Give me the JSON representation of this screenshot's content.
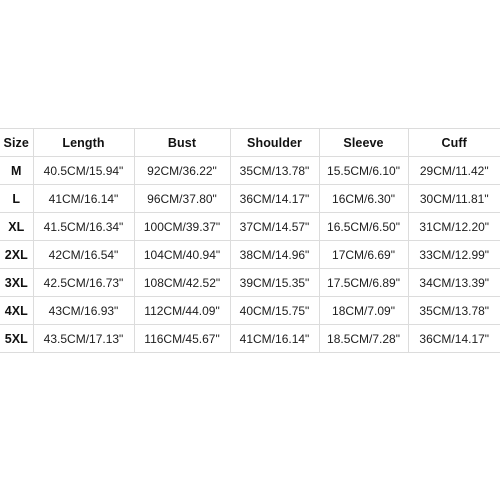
{
  "chart_data": {
    "type": "table",
    "title": "",
    "columns": [
      "Size",
      "Length",
      "Bust",
      "Shoulder",
      "Sleeve",
      "Cuff"
    ],
    "rows": [
      {
        "size": "M",
        "length": "40.5CM/15.94\"",
        "bust": "92CM/36.22\"",
        "shoulder": "35CM/13.78\"",
        "sleeve": "15.5CM/6.10\"",
        "cuff": "29CM/11.42\""
      },
      {
        "size": "L",
        "length": "41CM/16.14\"",
        "bust": "96CM/37.80\"",
        "shoulder": "36CM/14.17\"",
        "sleeve": "16CM/6.30\"",
        "cuff": "30CM/11.81\""
      },
      {
        "size": "XL",
        "length": "41.5CM/16.34\"",
        "bust": "100CM/39.37\"",
        "shoulder": "37CM/14.57\"",
        "sleeve": "16.5CM/6.50\"",
        "cuff": "31CM/12.20\""
      },
      {
        "size": "2XL",
        "length": "42CM/16.54\"",
        "bust": "104CM/40.94\"",
        "shoulder": "38CM/14.96\"",
        "sleeve": "17CM/6.69\"",
        "cuff": "33CM/12.99\""
      },
      {
        "size": "3XL",
        "length": "42.5CM/16.73\"",
        "bust": "108CM/42.52\"",
        "shoulder": "39CM/15.35\"",
        "sleeve": "17.5CM/6.89\"",
        "cuff": "34CM/13.39\""
      },
      {
        "size": "4XL",
        "length": "43CM/16.93\"",
        "bust": "112CM/44.09\"",
        "shoulder": "40CM/15.75\"",
        "sleeve": "18CM/7.09\"",
        "cuff": "35CM/13.78\""
      },
      {
        "size": "5XL",
        "length": "43.5CM/17.13\"",
        "bust": "116CM/45.67\"",
        "shoulder": "41CM/16.14\"",
        "sleeve": "18.5CM/7.28\"",
        "cuff": "36CM/14.17\""
      }
    ],
    "grid": true,
    "legend": "none",
    "colors": {
      "background": "#ffffff",
      "grid_line": "#dcdcdc",
      "header_text": "#111111",
      "body_text": "#1d1d1d"
    }
  }
}
